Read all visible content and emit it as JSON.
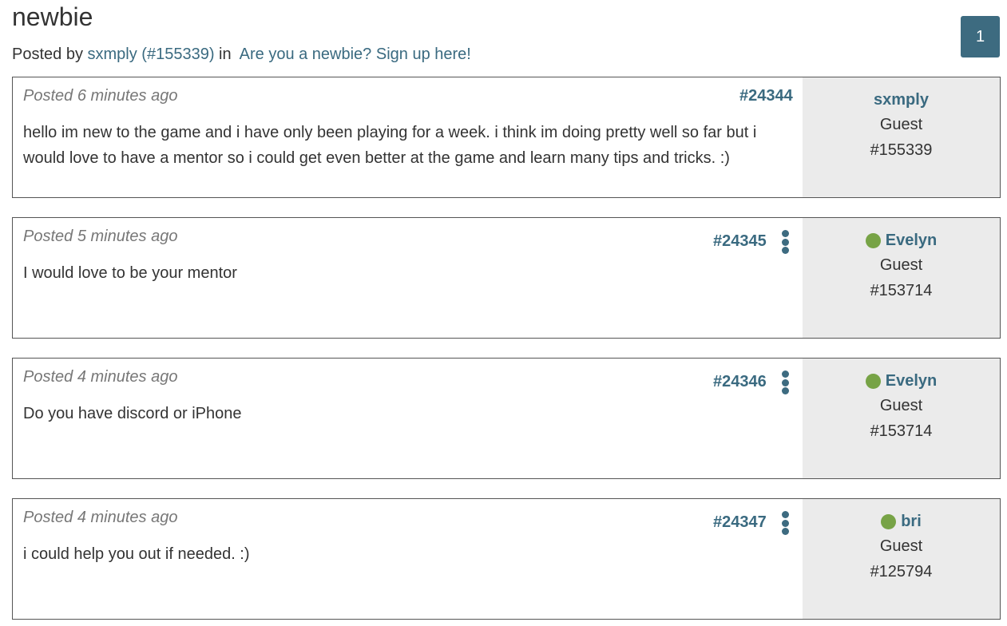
{
  "thread": {
    "title": "newbie",
    "posted_by_prefix": "Posted by",
    "author_link": "sxmply (#155339)",
    "in_word": "in",
    "forum_link": "Are you a newbie? Sign up here!"
  },
  "pagination": {
    "current_page": "1"
  },
  "colors": {
    "link": "#3a6a80",
    "accent": "#3d6b80",
    "online": "#77a346",
    "sidebar_bg": "#ebebeb"
  },
  "posts": [
    {
      "posted": "Posted 6 minutes ago",
      "id": "#24344",
      "body": "hello im new to the game and i have only been playing for a week. i think im doing pretty well so far but i would love to have a mentor so i could get even better at the game and learn many tips and tricks. :)",
      "user": {
        "name": "sxmply",
        "role": "Guest",
        "uid": "#155339",
        "online": false,
        "menu_icon": "more-vertical-icon"
      }
    },
    {
      "posted": "Posted 5 minutes ago",
      "id": "#24345",
      "body": "I would love to be your mentor",
      "user": {
        "name": "Evelyn",
        "role": "Guest",
        "uid": "#153714",
        "online": true
      }
    },
    {
      "posted": "Posted 4 minutes ago",
      "id": "#24346",
      "body": "Do you have discord or iPhone",
      "user": {
        "name": "Evelyn",
        "role": "Guest",
        "uid": "#153714",
        "online": true
      }
    },
    {
      "posted": "Posted 4 minutes ago",
      "id": "#24347",
      "body": "i could help you out if needed.  :)",
      "user": {
        "name": "bri",
        "role": "Guest",
        "uid": "#125794",
        "online": true
      }
    }
  ]
}
